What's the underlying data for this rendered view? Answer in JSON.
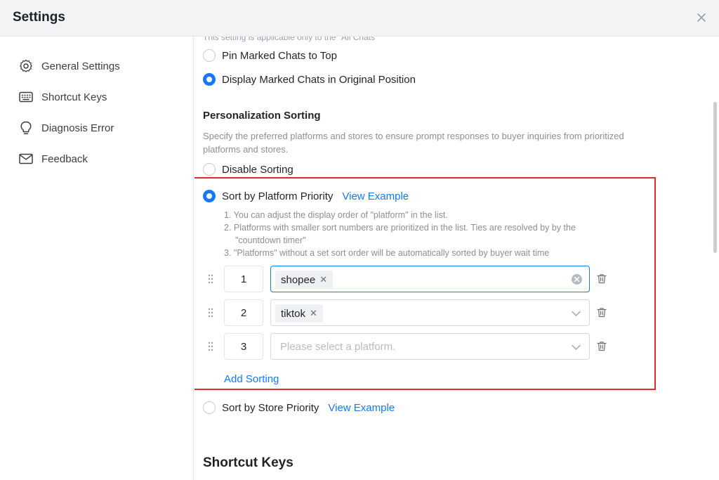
{
  "window": {
    "title": "Settings"
  },
  "sidebar": {
    "items": [
      {
        "label": "General Settings",
        "icon": "gear-icon"
      },
      {
        "label": "Shortcut Keys",
        "icon": "keyboard-icon"
      },
      {
        "label": "Diagnosis Error",
        "icon": "lightbulb-icon"
      },
      {
        "label": "Feedback",
        "icon": "mail-icon"
      }
    ]
  },
  "content": {
    "clipped_note": "This setting is applicable only to the \"All Chats\"",
    "marked_chats": {
      "options": [
        {
          "label": "Pin Marked Chats to Top",
          "selected": false
        },
        {
          "label": "Display Marked Chats in Original Position",
          "selected": true
        }
      ]
    },
    "personalization": {
      "title": "Personalization Sorting",
      "description": "Specify the preferred platforms and stores to ensure prompt responses to buyer inquiries from prioritized platforms and stores.",
      "disable_label": "Disable Sorting",
      "platform_priority": {
        "label": "Sort by Platform Priority",
        "link": "View Example",
        "selected": true,
        "rules": {
          "r1": "1. You can adjust the display order of \"platform\" in the list.",
          "r2": "2. Platforms with smaller sort numbers are prioritized in the list. Ties are resolved by by the",
          "r2b": "\"countdown timer\"",
          "r3": "3. \"Platforms\" without a set sort order will be automatically sorted by buyer wait time"
        },
        "rows": [
          {
            "number": "1",
            "tag": "shopee"
          },
          {
            "number": "2",
            "tag": "tiktok"
          },
          {
            "number": "3",
            "placeholder": "Please select a platform."
          }
        ],
        "add_label": "Add Sorting"
      },
      "store_priority": {
        "label": "Sort by Store Priority",
        "link": "View Example",
        "selected": false
      }
    },
    "shortcut_heading": "Shortcut Keys"
  },
  "colors": {
    "accent": "#1677ff",
    "highlight": "#e02b2b"
  }
}
